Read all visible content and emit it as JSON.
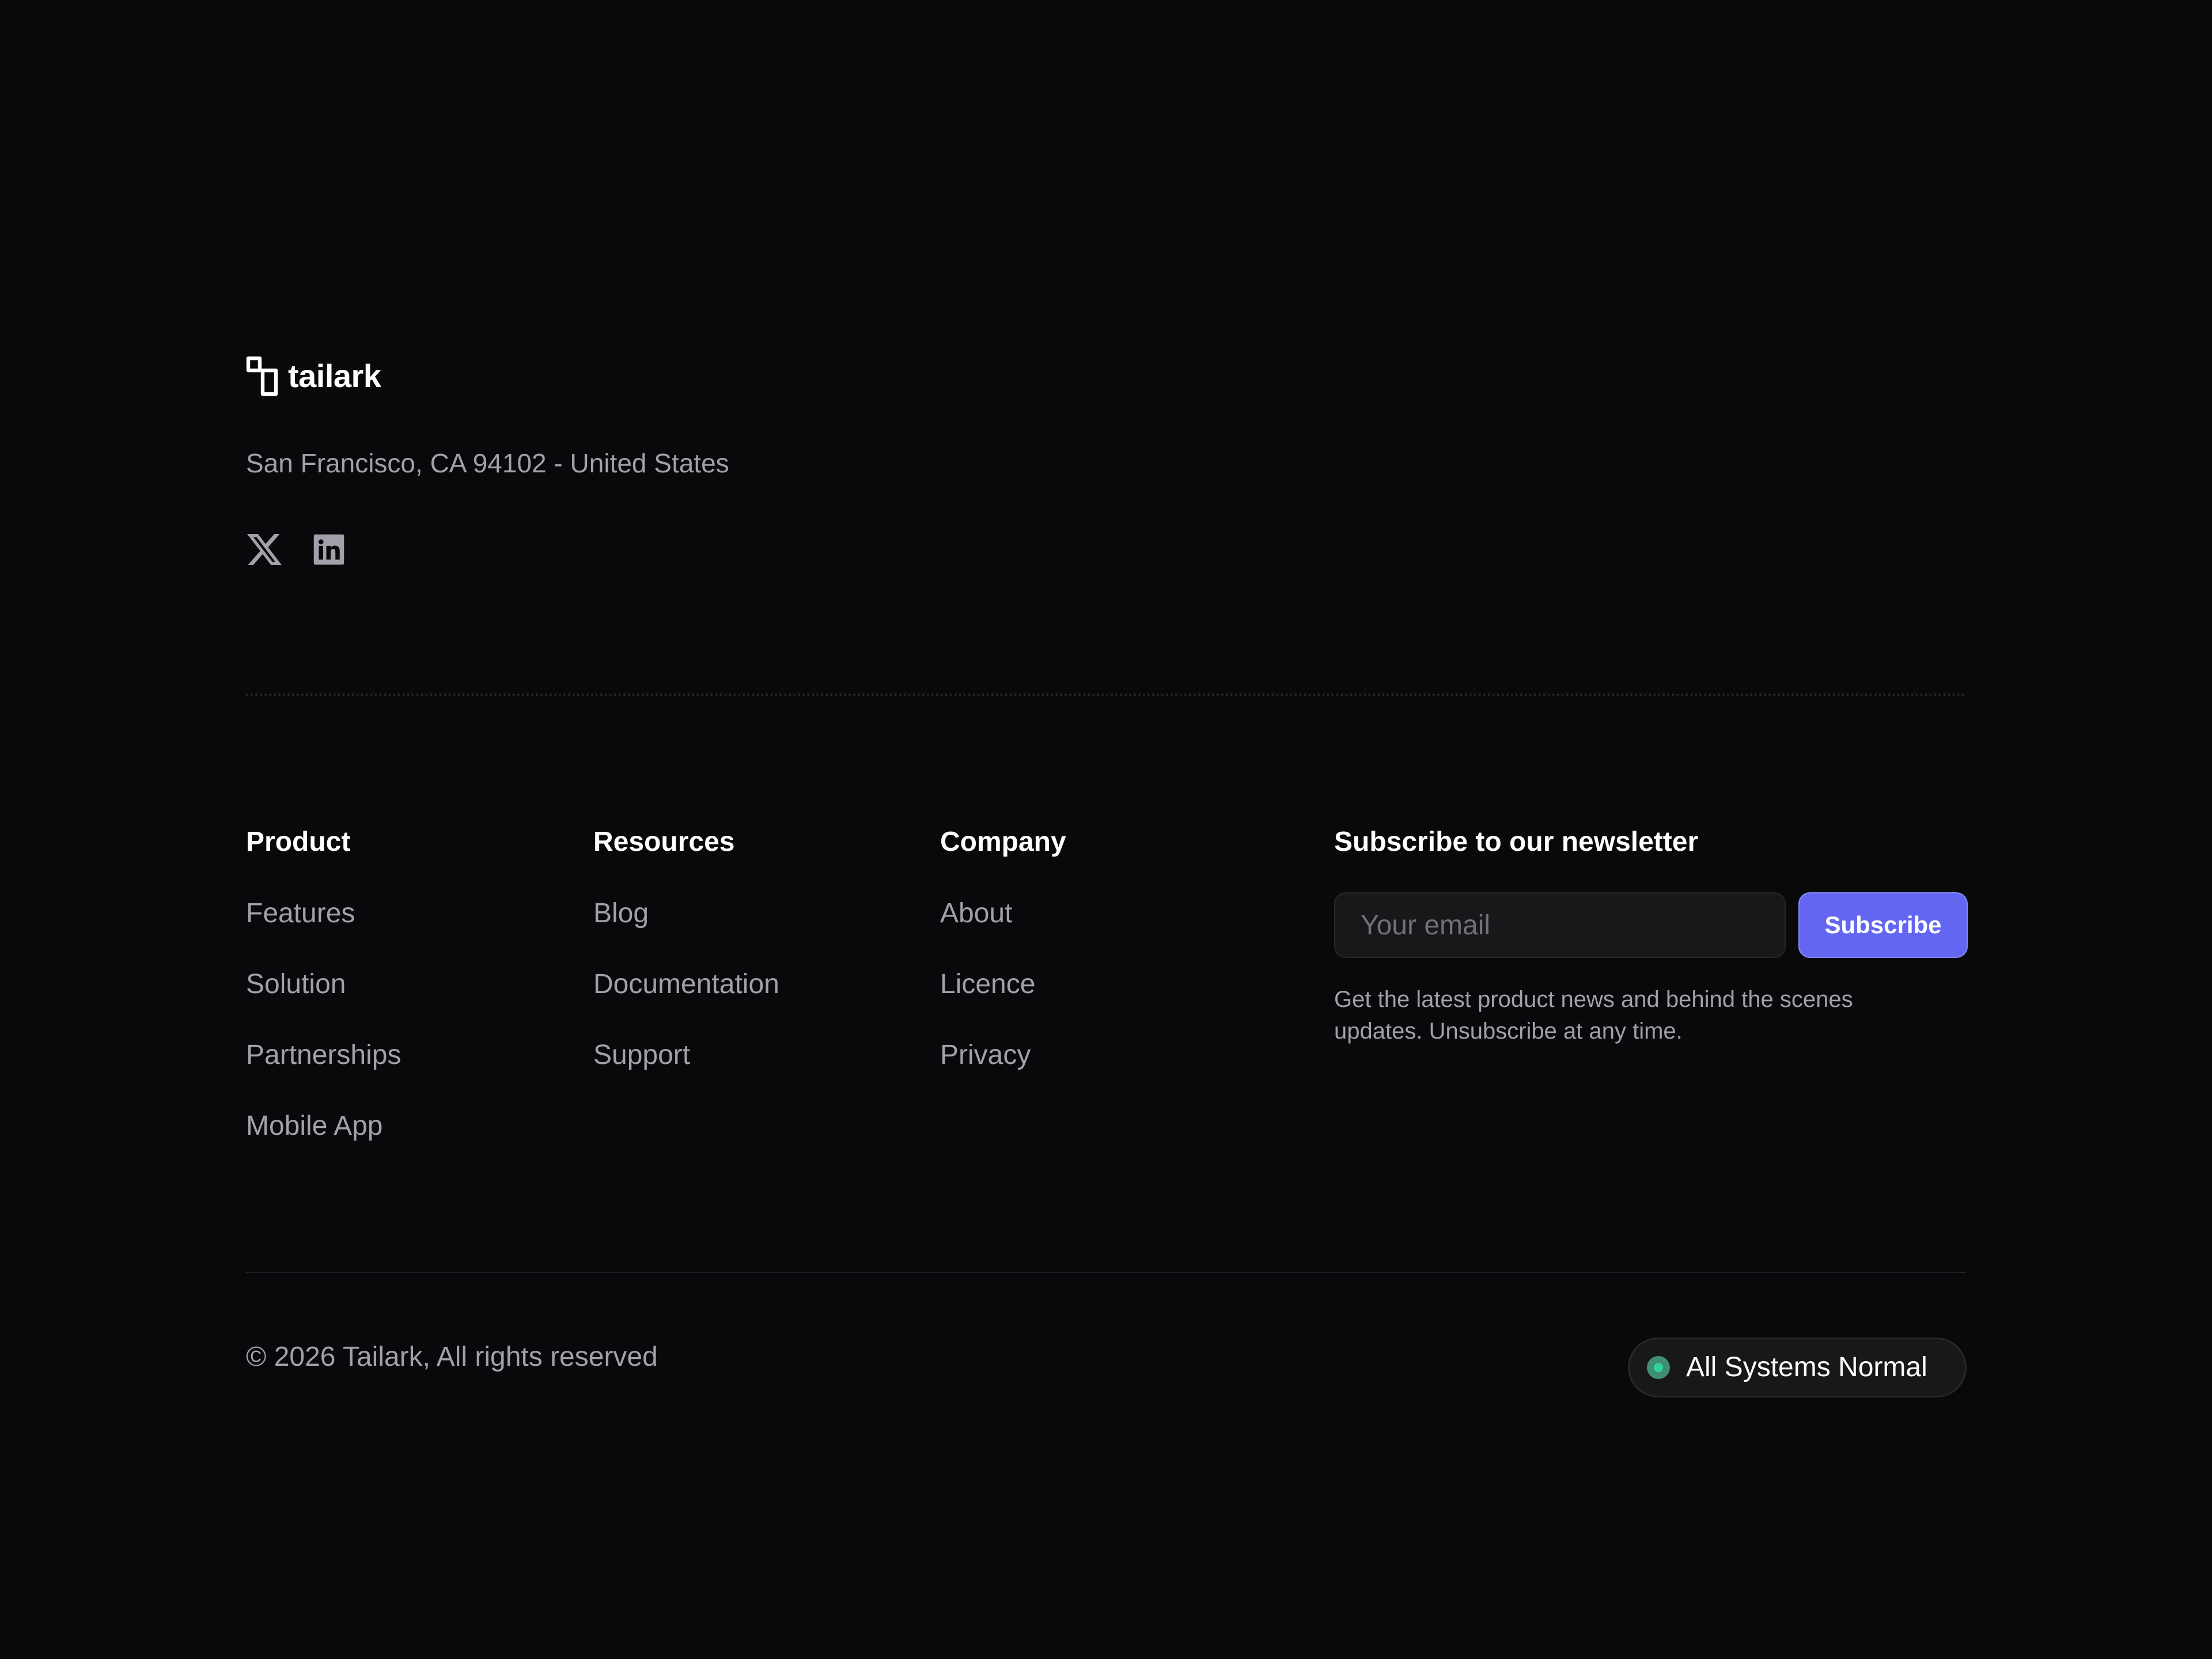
{
  "brand": {
    "name": "tailark",
    "logo_icon": "tailark-logo-icon"
  },
  "address": "San Francisco, CA 94102 - United States",
  "social": [
    {
      "icon": "x-twitter-icon"
    },
    {
      "icon": "linkedin-icon"
    }
  ],
  "columns": {
    "product": {
      "heading": "Product",
      "links": [
        "Features",
        "Solution",
        "Partnerships",
        "Mobile App"
      ]
    },
    "resources": {
      "heading": "Resources",
      "links": [
        "Blog",
        "Documentation",
        "Support"
      ]
    },
    "company": {
      "heading": "Company",
      "links": [
        "About",
        "Licence",
        "Privacy"
      ]
    }
  },
  "newsletter": {
    "heading": "Subscribe to our newsletter",
    "email_placeholder": "Your email",
    "email_value": "",
    "button_label": "Subscribe",
    "note": "Get the latest product news and behind the scenes updates. Unsubscribe at any time."
  },
  "copyright": "© 2026 Tailark, All rights reserved",
  "status": {
    "label": "All Systems Normal",
    "color": "#34d399"
  },
  "colors": {
    "background": "#09090b",
    "accent": "#6366f1",
    "muted_text": "#a1a1aa"
  }
}
